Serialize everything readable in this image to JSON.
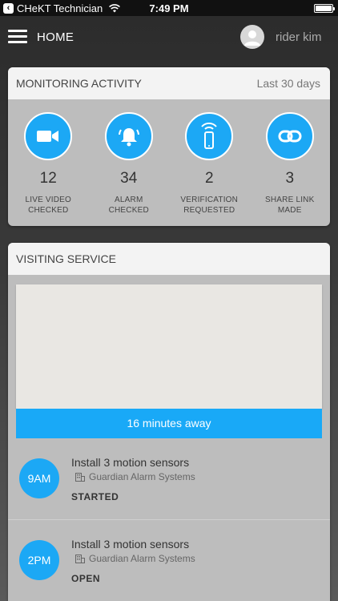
{
  "status_bar": {
    "back_label": "CHeKT Technician",
    "time": "7:49 PM"
  },
  "header": {
    "title": "HOME",
    "user_name": "rider kim"
  },
  "monitoring": {
    "title": "MONITORING ACTIVITY",
    "period": "Last 30 days",
    "stats": [
      {
        "icon": "video-camera-icon",
        "value": "12",
        "label_line1": "LIVE VIDEO",
        "label_line2": "CHECKED"
      },
      {
        "icon": "alarm-bell-icon",
        "value": "34",
        "label_line1": "ALARM",
        "label_line2": "CHECKED"
      },
      {
        "icon": "phone-signal-icon",
        "value": "2",
        "label_line1": "VERIFICATION",
        "label_line2": "REQUESTED"
      },
      {
        "icon": "link-icon",
        "value": "3",
        "label_line1": "SHARE LINK",
        "label_line2": "MADE"
      }
    ]
  },
  "visiting": {
    "title": "VISITING SERVICE",
    "eta": "16 minutes away",
    "items": [
      {
        "time": "9AM",
        "title": "Install 3 motion sensors",
        "company": "Guardian Alarm Systems",
        "status": "STARTED"
      },
      {
        "time": "2PM",
        "title": "Install 3 motion sensors",
        "company": "Guardian Alarm Systems",
        "status": "OPEN"
      }
    ]
  },
  "colors": {
    "accent": "#1ca8f5",
    "card_bg": "#bdbdbd",
    "card_header_bg": "#f3f3f3"
  }
}
